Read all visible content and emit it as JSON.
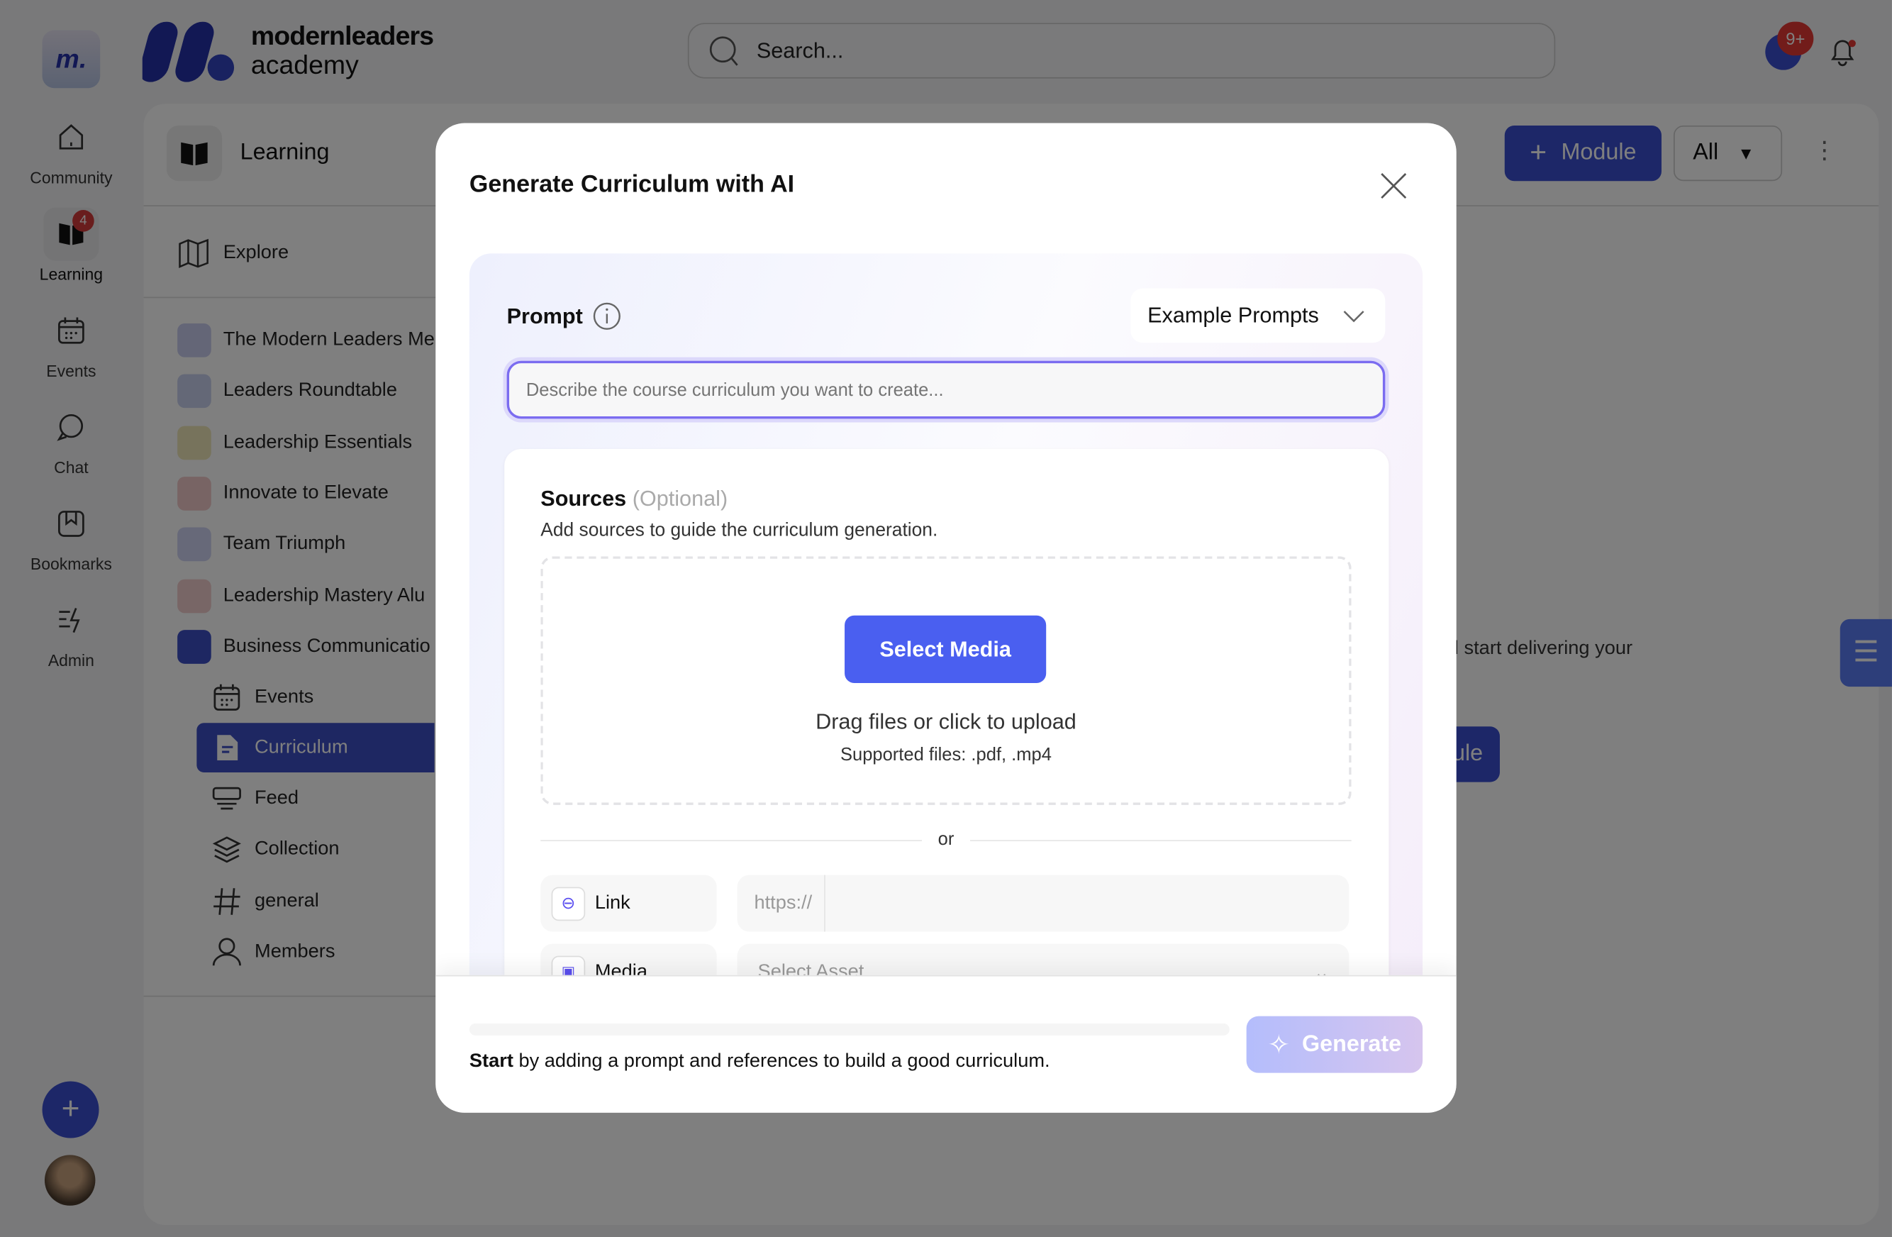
{
  "brand": {
    "line1": "modernleaders",
    "line2": "academy",
    "color": "#2431a8"
  },
  "search": {
    "placeholder": "Search..."
  },
  "notifications": {
    "badge": "9+"
  },
  "rail": [
    {
      "label": "Community",
      "icon": "home-icon"
    },
    {
      "label": "Learning",
      "icon": "book-icon",
      "badge": "4"
    },
    {
      "label": "Events",
      "icon": "calendar-icon"
    },
    {
      "label": "Chat",
      "icon": "chat-icon"
    },
    {
      "label": "Bookmarks",
      "icon": "bookmark-icon"
    },
    {
      "label": "Admin",
      "icon": "admin-icon"
    }
  ],
  "sidebar": {
    "title": "Learning",
    "explore": "Explore",
    "products": [
      "The Modern Leaders Me",
      "Leaders Roundtable",
      "Leadership Essentials",
      "Innovate to Elevate",
      "Team Triumph",
      "Leadership Mastery Alu",
      "Business Communicatio"
    ],
    "sub_items": [
      {
        "label": "Events",
        "icon": "calendar-icon"
      },
      {
        "label": "Curriculum",
        "icon": "document-icon",
        "active": true
      },
      {
        "label": "Feed",
        "icon": "feed-icon"
      },
      {
        "label": "Collection",
        "icon": "layers-icon"
      },
      {
        "label": "general",
        "icon": "hash-icon"
      },
      {
        "label": "Members",
        "icon": "user-icon"
      }
    ]
  },
  "main": {
    "module_button": "Module",
    "filter_value": "All",
    "empty_text": "d start delivering your",
    "empty_button": "ule"
  },
  "modal": {
    "title": "Generate Curriculum with AI",
    "prompt_label": "Prompt",
    "example_prompts": "Example Prompts",
    "prompt_placeholder": "Describe the course curriculum you want to create...",
    "sources_title": "Sources",
    "sources_optional": "(Optional)",
    "sources_subtitle": "Add sources to guide the curriculum generation.",
    "select_media": "Select Media",
    "drag_text": "Drag files or click to upload",
    "supported": "Supported files: .pdf, .mp4",
    "or": "or",
    "link_label": "Link",
    "link_placeholder": "https://",
    "media_label": "Media",
    "media_placeholder": "Select Asset",
    "footer_bold": "Start",
    "footer_text": " by adding a prompt and references to build a good curriculum.",
    "generate": "Generate",
    "progress": 0
  },
  "colors": {
    "accent": "#4a5ff0",
    "active_nav": "#3d4fc4",
    "prompt_border": "#7b6cf0"
  }
}
